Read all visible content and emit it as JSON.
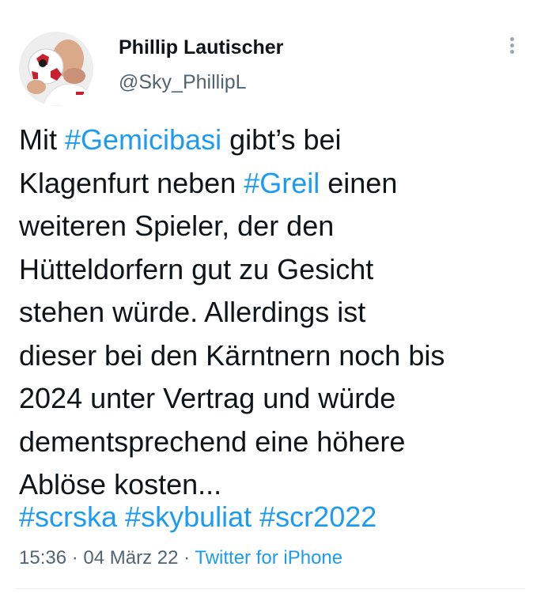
{
  "author": {
    "name": "Phillip Lautischer",
    "handle": "@Sky_PhillipL",
    "avatar_icon": "profile-photo"
  },
  "more_icon": "more-vertical-icon",
  "tweet": {
    "lines": [
      [
        {
          "t": "Mit ",
          "link": false
        },
        {
          "t": "#Gemicibasi",
          "link": true
        },
        {
          "t": " gibt’s bei",
          "link": false
        }
      ],
      [
        {
          "t": "Klagenfurt neben ",
          "link": false
        },
        {
          "t": "#Greil",
          "link": true
        },
        {
          "t": " einen",
          "link": false
        }
      ],
      [
        {
          "t": "weiteren Spieler, der den",
          "link": false
        }
      ],
      [
        {
          "t": "Hütteldorfern gut zu Gesicht",
          "link": false
        }
      ],
      [
        {
          "t": "stehen würde. Allerdings ist",
          "link": false
        }
      ],
      [
        {
          "t": "dieser bei den Kärntnern noch bis",
          "link": false
        }
      ],
      [
        {
          "t": "2024 unter Vertrag und würde",
          "link": false
        }
      ],
      [
        {
          "t": "dementsprechend eine höhere",
          "link": false
        }
      ],
      [
        {
          "t": "Ablöse kosten...",
          "link": false
        }
      ]
    ],
    "hashtags": [
      "#scrska",
      "#skybuliat",
      "#scr2022"
    ]
  },
  "meta": {
    "time": "15:36",
    "separator": " · ",
    "date": "04 März 22",
    "source": "Twitter for iPhone"
  },
  "colors": {
    "link": "#1d9bf0",
    "text": "#0f1419",
    "secondary": "#536471"
  }
}
